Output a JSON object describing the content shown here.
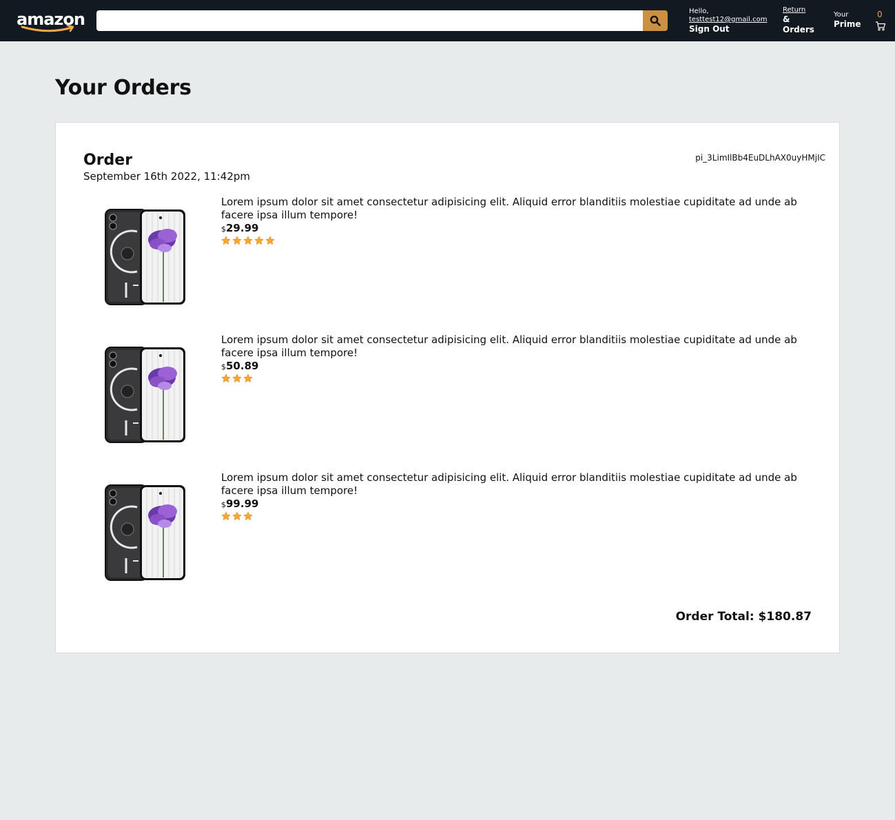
{
  "header": {
    "logo_text": "amazon",
    "search": {
      "placeholder": "",
      "value": ""
    },
    "account": {
      "greeting": "Hello,",
      "email": "testtest12@gmail.com",
      "action": "Sign Out"
    },
    "returns": {
      "line1": "Return",
      "line2": "&",
      "line3": "Orders"
    },
    "prime": {
      "line1": "Your",
      "line2": "Prime"
    },
    "cart_count": "0"
  },
  "page": {
    "title": "Your Orders"
  },
  "order": {
    "heading": "Order",
    "date": "September 16th 2022, 11:42pm",
    "id": "pi_3LimIlBb4EuDLhAX0uyHMjIC",
    "items": [
      {
        "description": "Lorem ipsum dolor sit amet consectetur adipisicing elit. Aliquid error blanditiis molestiae cupiditate ad unde ab facere ipsa illum tempore!",
        "currency": "$",
        "price": "29.99",
        "rating": 5
      },
      {
        "description": "Lorem ipsum dolor sit amet consectetur adipisicing elit. Aliquid error blanditiis molestiae cupiditate ad unde ab facere ipsa illum tempore!",
        "currency": "$",
        "price": "50.89",
        "rating": 3
      },
      {
        "description": "Lorem ipsum dolor sit amet consectetur adipisicing elit. Aliquid error blanditiis molestiae cupiditate ad unde ab facere ipsa illum tempore!",
        "currency": "$",
        "price": "99.99",
        "rating": 3
      }
    ],
    "total_label": "Order Total: $180.87"
  },
  "colors": {
    "header_bg": "#131921",
    "search_button": "#cd9042",
    "star": "#f7a833",
    "page_bg": "#e8ebec"
  },
  "icons": {
    "search": "search-icon",
    "cart": "cart-icon",
    "star": "star-icon",
    "logo_arrow": "smile-arrow-icon"
  }
}
